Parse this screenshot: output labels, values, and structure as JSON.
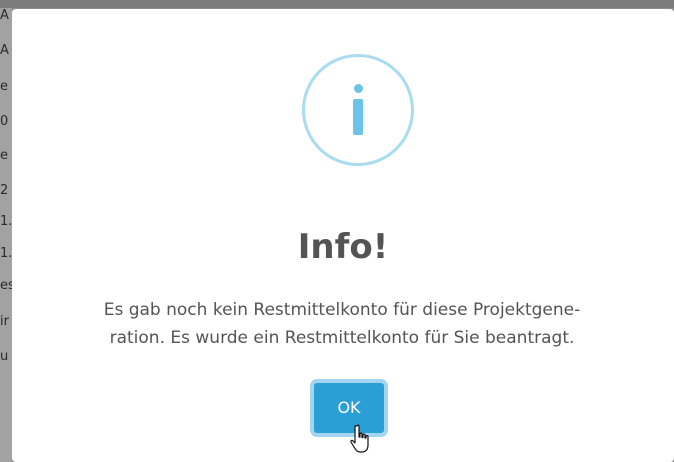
{
  "background_fragments": [
    "A",
    "A",
    "e",
    "0",
    "e",
    "2",
    "1.",
    "1.",
    "es",
    "ir",
    "u"
  ],
  "dialog": {
    "icon": "info-icon",
    "title": "Info!",
    "message_line1": "Es gab noch kein Restmittelkonto für diese Projektgene-",
    "message_line2": "ration. Es wurde ein Restmittelkonto für Sie beantragt.",
    "ok_label": "OK"
  },
  "colors": {
    "accent": "#2a9fd6",
    "icon_ring": "#a9dcf0",
    "icon_glyph": "#6cc3e8",
    "text": "#545454"
  },
  "cursor": "hand-pointer-icon"
}
